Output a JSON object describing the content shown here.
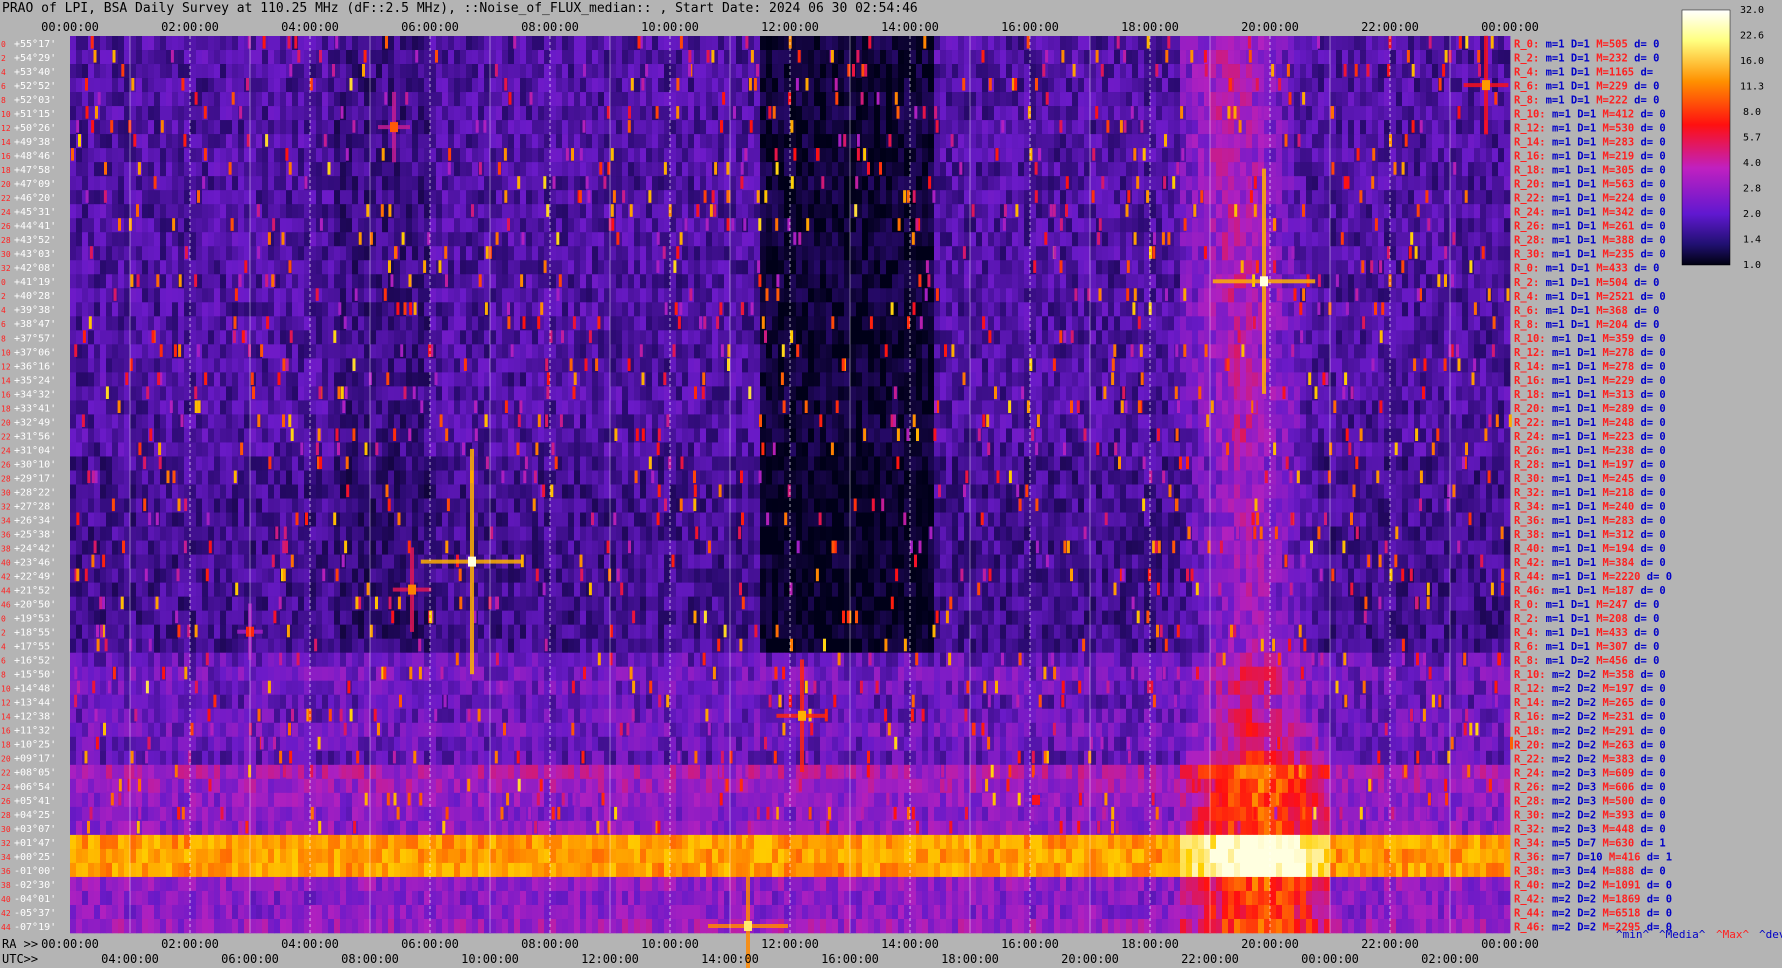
{
  "title": "PRAO of LPI, BSA Daily Survey at 110.25 MHz (dF::2.5 MHz), ::Noise_of_FLUX_median:: , Start Date: 2024 06 30 02:54:46",
  "chart_data": {
    "type": "heatmap",
    "title": "PRAO of LPI, BSA Daily Survey at 110.25 MHz (dF::2.5 MHz), ::Noise_of_FLUX_median:: , Start Date: 2024 06 30 02:54:46",
    "top_time_ticks": [
      "00:00:00",
      "02:00:00",
      "04:00:00",
      "06:00:00",
      "08:00:00",
      "10:00:00",
      "12:00:00",
      "14:00:00",
      "16:00:00",
      "18:00:00",
      "20:00:00",
      "22:00:00",
      "00:00:00"
    ],
    "bottom_ra_label": "RA >>",
    "bottom_ra_ticks": [
      "00:00:00",
      "02:00:00",
      "04:00:00",
      "06:00:00",
      "08:00:00",
      "10:00:00",
      "12:00:00",
      "14:00:00",
      "16:00:00",
      "18:00:00",
      "20:00:00",
      "22:00:00",
      "00:00:00"
    ],
    "bottom_utc_label": "UTC>>",
    "bottom_utc_ticks": [
      "04:00:00",
      "06:00:00",
      "08:00:00",
      "10:00:00",
      "12:00:00",
      "14:00:00",
      "16:00:00",
      "18:00:00",
      "20:00:00",
      "22:00:00",
      "00:00:00",
      "02:00:00"
    ],
    "declinations": [
      "+55°17'",
      "+54°29'",
      "+53°40'",
      "+52°52'",
      "+52°03'",
      "+51°15'",
      "+50°26'",
      "+49°38'",
      "+48°46'",
      "+47°58'",
      "+47°09'",
      "+46°20'",
      "+45°31'",
      "+44°41'",
      "+43°52'",
      "+43°03'",
      "+42°08'",
      "+41°19'",
      "+40°28'",
      "+39°38'",
      "+38°47'",
      "+37°57'",
      "+37°06'",
      "+36°16'",
      "+35°24'",
      "+34°32'",
      "+33°41'",
      "+32°49'",
      "+31°56'",
      "+31°04'",
      "+30°10'",
      "+29°17'",
      "+28°22'",
      "+27°28'",
      "+26°34'",
      "+25°38'",
      "+24°42'",
      "+23°46'",
      "+22°49'",
      "+21°52'",
      "+20°50'",
      "+19°53'",
      "+18°55'",
      "+17°55'",
      "+16°52'",
      "+15°50'",
      "+14°48'",
      "+13°44'",
      "+12°38'",
      "+11°32'",
      "+10°25'",
      "+09°17'",
      "+08°05'",
      "+06°54'",
      "+05°41'",
      "+04°25'",
      "+03°07'",
      "+01°47'",
      "+00°25'",
      "-01°00'",
      "-02°30'",
      "-04°01'",
      "-05°37'",
      "-07°19'"
    ],
    "beam_index": [
      "0",
      "2",
      "4",
      "6",
      "8",
      "10",
      "12",
      "14",
      "16",
      "18",
      "20",
      "22",
      "24",
      "26",
      "28",
      "30",
      "32",
      "0",
      "2",
      "4",
      "6",
      "8",
      "10",
      "12",
      "14",
      "16",
      "18",
      "20",
      "22",
      "24",
      "26",
      "28",
      "30",
      "32",
      "34",
      "36",
      "38",
      "40",
      "42",
      "44",
      "46",
      "0",
      "2",
      "4",
      "6",
      "8",
      "10",
      "12",
      "14",
      "16",
      "18",
      "20",
      "22",
      "24",
      "26",
      "28",
      "30",
      "32",
      "34",
      "36",
      "38",
      "40",
      "42",
      "44"
    ],
    "row_stats": [
      {
        "label": "R_0:",
        "m": "1",
        "D": "1",
        "M": "505",
        "d": "0"
      },
      {
        "label": "R_2:",
        "m": "1",
        "D": "1",
        "M": "232",
        "d": "0"
      },
      {
        "label": "R_4:",
        "m": "1",
        "D": "1",
        "M": "1165",
        "d": ""
      },
      {
        "label": "R_6:",
        "m": "1",
        "D": "1",
        "M": "229",
        "d": "0"
      },
      {
        "label": "R_8:",
        "m": "1",
        "D": "1",
        "M": "222",
        "d": "0"
      },
      {
        "label": "R_10:",
        "m": "1",
        "D": "1",
        "M": "412",
        "d": "0"
      },
      {
        "label": "R_12:",
        "m": "1",
        "D": "1",
        "M": "530",
        "d": "0"
      },
      {
        "label": "R_14:",
        "m": "1",
        "D": "1",
        "M": "283",
        "d": "0"
      },
      {
        "label": "R_16:",
        "m": "1",
        "D": "1",
        "M": "219",
        "d": "0"
      },
      {
        "label": "R_18:",
        "m": "1",
        "D": "1",
        "M": "305",
        "d": "0"
      },
      {
        "label": "R_20:",
        "m": "1",
        "D": "1",
        "M": "563",
        "d": "0"
      },
      {
        "label": "R_22:",
        "m": "1",
        "D": "1",
        "M": "224",
        "d": "0"
      },
      {
        "label": "R_24:",
        "m": "1",
        "D": "1",
        "M": "342",
        "d": "0"
      },
      {
        "label": "R_26:",
        "m": "1",
        "D": "1",
        "M": "261",
        "d": "0"
      },
      {
        "label": "R_28:",
        "m": "1",
        "D": "1",
        "M": "388",
        "d": "0"
      },
      {
        "label": "R_30:",
        "m": "1",
        "D": "1",
        "M": "235",
        "d": "0"
      },
      {
        "label": "R_0:",
        "m": "1",
        "D": "1",
        "M": "433",
        "d": "0"
      },
      {
        "label": "R_2:",
        "m": "1",
        "D": "1",
        "M": "504",
        "d": "0"
      },
      {
        "label": "R_4:",
        "m": "1",
        "D": "1",
        "M": "2521",
        "d": "0"
      },
      {
        "label": "R_6:",
        "m": "1",
        "D": "1",
        "M": "368",
        "d": "0"
      },
      {
        "label": "R_8:",
        "m": "1",
        "D": "1",
        "M": "204",
        "d": "0"
      },
      {
        "label": "R_10:",
        "m": "1",
        "D": "1",
        "M": "359",
        "d": "0"
      },
      {
        "label": "R_12:",
        "m": "1",
        "D": "1",
        "M": "278",
        "d": "0"
      },
      {
        "label": "R_14:",
        "m": "1",
        "D": "1",
        "M": "278",
        "d": "0"
      },
      {
        "label": "R_16:",
        "m": "1",
        "D": "1",
        "M": "229",
        "d": "0"
      },
      {
        "label": "R_18:",
        "m": "1",
        "D": "1",
        "M": "313",
        "d": "0"
      },
      {
        "label": "R_20:",
        "m": "1",
        "D": "1",
        "M": "289",
        "d": "0"
      },
      {
        "label": "R_22:",
        "m": "1",
        "D": "1",
        "M": "248",
        "d": "0"
      },
      {
        "label": "R_24:",
        "m": "1",
        "D": "1",
        "M": "223",
        "d": "0"
      },
      {
        "label": "R_26:",
        "m": "1",
        "D": "1",
        "M": "238",
        "d": "0"
      },
      {
        "label": "R_28:",
        "m": "1",
        "D": "1",
        "M": "197",
        "d": "0"
      },
      {
        "label": "R_30:",
        "m": "1",
        "D": "1",
        "M": "245",
        "d": "0"
      },
      {
        "label": "R_32:",
        "m": "1",
        "D": "1",
        "M": "218",
        "d": "0"
      },
      {
        "label": "R_34:",
        "m": "1",
        "D": "1",
        "M": "240",
        "d": "0"
      },
      {
        "label": "R_36:",
        "m": "1",
        "D": "1",
        "M": "283",
        "d": "0"
      },
      {
        "label": "R_38:",
        "m": "1",
        "D": "1",
        "M": "312",
        "d": "0"
      },
      {
        "label": "R_40:",
        "m": "1",
        "D": "1",
        "M": "194",
        "d": "0"
      },
      {
        "label": "R_42:",
        "m": "1",
        "D": "1",
        "M": "384",
        "d": "0"
      },
      {
        "label": "R_44:",
        "m": "1",
        "D": "1",
        "M": "2220",
        "d": "0"
      },
      {
        "label": "R_46:",
        "m": "1",
        "D": "1",
        "M": "187",
        "d": "0"
      },
      {
        "label": "R_0:",
        "m": "1",
        "D": "1",
        "M": "247",
        "d": "0"
      },
      {
        "label": "R_2:",
        "m": "1",
        "D": "1",
        "M": "208",
        "d": "0"
      },
      {
        "label": "R_4:",
        "m": "1",
        "D": "1",
        "M": "433",
        "d": "0"
      },
      {
        "label": "R_6:",
        "m": "1",
        "D": "1",
        "M": "307",
        "d": "0"
      },
      {
        "label": "R_8:",
        "m": "1",
        "D": "2",
        "M": "456",
        "d": "0"
      },
      {
        "label": "R_10:",
        "m": "2",
        "D": "2",
        "M": "358",
        "d": "0"
      },
      {
        "label": "R_12:",
        "m": "2",
        "D": "2",
        "M": "197",
        "d": "0"
      },
      {
        "label": "R_14:",
        "m": "2",
        "D": "2",
        "M": "265",
        "d": "0"
      },
      {
        "label": "R_16:",
        "m": "2",
        "D": "2",
        "M": "231",
        "d": "0"
      },
      {
        "label": "R_18:",
        "m": "2",
        "D": "2",
        "M": "291",
        "d": "0"
      },
      {
        "label": "R_20:",
        "m": "2",
        "D": "2",
        "M": "263",
        "d": "0"
      },
      {
        "label": "R_22:",
        "m": "2",
        "D": "2",
        "M": "383",
        "d": "0"
      },
      {
        "label": "R_24:",
        "m": "2",
        "D": "3",
        "M": "609",
        "d": "0"
      },
      {
        "label": "R_26:",
        "m": "2",
        "D": "3",
        "M": "606",
        "d": "0"
      },
      {
        "label": "R_28:",
        "m": "2",
        "D": "3",
        "M": "500",
        "d": "0"
      },
      {
        "label": "R_30:",
        "m": "2",
        "D": "2",
        "M": "393",
        "d": "0"
      },
      {
        "label": "R_32:",
        "m": "2",
        "D": "3",
        "M": "448",
        "d": "0"
      },
      {
        "label": "R_34:",
        "m": "5",
        "D": "7",
        "M": "630",
        "d": "1"
      },
      {
        "label": "R_36:",
        "m": "7",
        "D": "10",
        "M": "416",
        "d": "1"
      },
      {
        "label": "R_38:",
        "m": "3",
        "D": "4",
        "M": "888",
        "d": "0"
      },
      {
        "label": "R_40:",
        "m": "2",
        "D": "2",
        "M": "1091",
        "d": "0"
      },
      {
        "label": "R_42:",
        "m": "2",
        "D": "2",
        "M": "1869",
        "d": "0"
      },
      {
        "label": "R_44:",
        "m": "2",
        "D": "2",
        "M": "6518",
        "d": "0"
      },
      {
        "label": "R_46:",
        "m": "2",
        "D": "2",
        "M": "2295",
        "d": "0"
      }
    ],
    "footer_legend": [
      {
        "text": "^min^",
        "color": "#0000c8"
      },
      {
        "text": "^Media^",
        "color": "#0000c8"
      },
      {
        "text": "^Max^",
        "color": "#ff2020"
      },
      {
        "text": "^devia^",
        "color": "#0000c8"
      }
    ],
    "colorbar_ticks": [
      "32.0",
      "22.6",
      "16.0",
      "11.3",
      "8.0",
      "5.7",
      "4.0",
      "2.8",
      "2.0",
      "1.4",
      "1.0"
    ],
    "colorbar_range": [
      1.0,
      32.0
    ],
    "colorbar_scale": "log",
    "colormap": [
      "#000018",
      "#2a0a70",
      "#6a1ac8",
      "#b020c0",
      "#ff1010",
      "#ff8000",
      "#ffd000",
      "#ffffe0"
    ],
    "bright_sources": [
      {
        "ra_hours": 6.7,
        "dec_index": 37,
        "intensity": 32
      },
      {
        "ra_hours": 19.9,
        "dec_index": 17,
        "intensity": 32
      },
      {
        "ra_hours": 11.3,
        "dec_index": 63,
        "intensity": 25
      },
      {
        "ra_hours": 12.2,
        "dec_index": 48,
        "intensity": 16
      },
      {
        "ra_hours": 5.7,
        "dec_index": 39,
        "intensity": 12
      },
      {
        "ra_hours": 23.6,
        "dec_index": 3,
        "intensity": 14
      },
      {
        "ra_hours": 5.4,
        "dec_index": 6,
        "intensity": 10
      },
      {
        "ra_hours": 3.0,
        "dec_index": 42,
        "intensity": 8
      },
      {
        "ra_hours": 16.1,
        "dec_index": 54,
        "intensity": 7
      }
    ],
    "equator_band": {
      "dec_rows": [
        57,
        58,
        59
      ],
      "intensity": 14
    },
    "galactic_arm_ra_hours": [
      18.5,
      21.0
    ],
    "grid": true
  }
}
